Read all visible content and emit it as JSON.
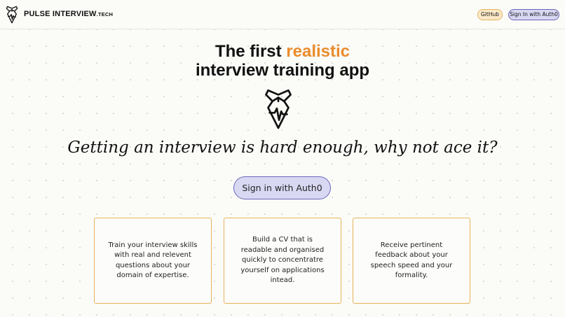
{
  "header": {
    "brand_main": "PULSE INTERVIEW",
    "brand_suffix": ".TECH",
    "logo_icon": "tie-pulse-icon",
    "github_label": "GitHub",
    "signin_label": "Sign In with Auth0"
  },
  "hero": {
    "headline_prefix": "The first ",
    "headline_accent": "realistic",
    "headline_line2": "interview training app",
    "accent_color": "#ea8c2d",
    "logo_icon": "tie-pulse-icon",
    "tagline": "Getting an interview is hard enough, why not ace it?",
    "cta_label": "Sign in with Auth0"
  },
  "features": [
    {
      "text": "Train your interview skills with real and relevent questions about your domain of expertise."
    },
    {
      "text": "Build a CV that is readable and organised quickly to concentratre yourself on applications intead."
    },
    {
      "text": "Receive pertinent feedback about your speech speed and your formality."
    }
  ],
  "colors": {
    "github_pill_bg": "#fde9c7",
    "auth_pill_bg": "#d9d8f3",
    "card_border": "#e7b35a"
  }
}
